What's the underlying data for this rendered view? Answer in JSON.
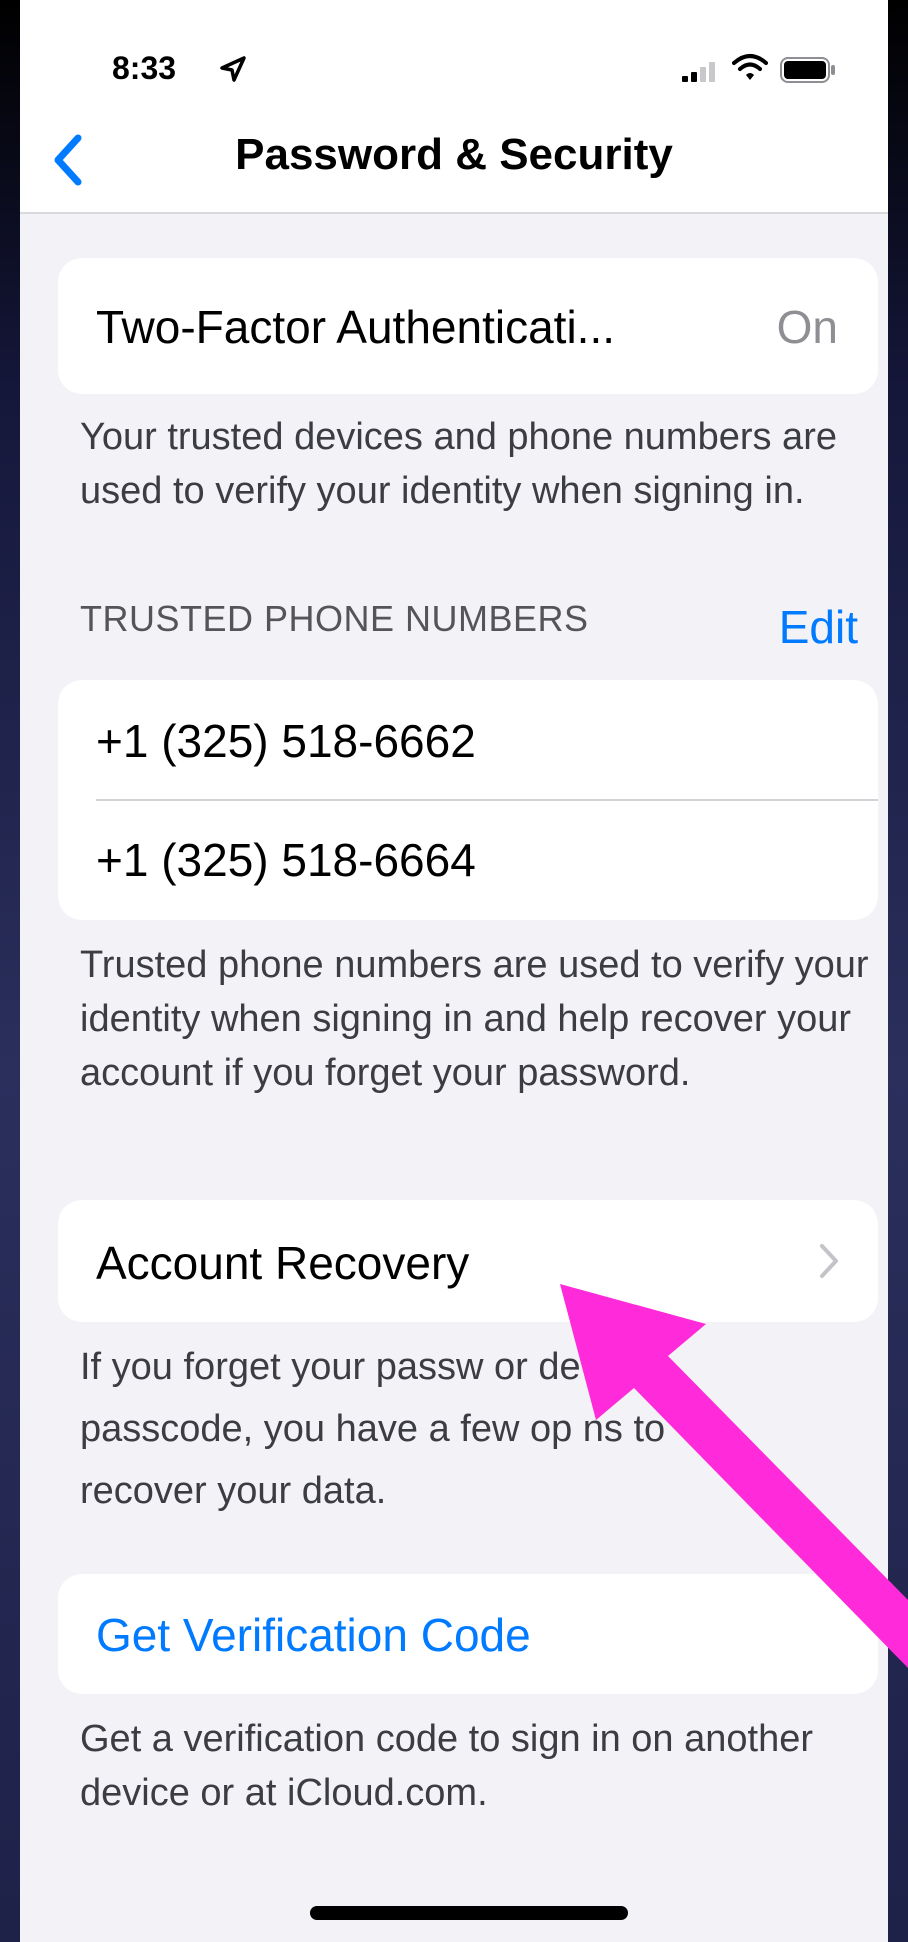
{
  "status_bar": {
    "time": "8:33"
  },
  "nav": {
    "title": "Password & Security"
  },
  "two_factor": {
    "label": "Two-Factor Authenticati...",
    "value": "On"
  },
  "two_factor_footer": "Your trusted devices and phone numbers are used to verify your identity when signing in.",
  "trusted_numbers": {
    "header": "TRUSTED PHONE NUMBERS",
    "edit_label": "Edit",
    "numbers": [
      "+1 (325) 518-6662",
      "+1 (325) 518-6664"
    ],
    "footer": "Trusted phone numbers are used to verify your identity when signing in and help recover your account if you forget your password."
  },
  "account_recovery": {
    "label": "Account Recovery",
    "footer_lines": [
      "If you forget your passw or device",
      "passcode, you have a few op ns to",
      "recover your data."
    ]
  },
  "verification": {
    "label": "Get Verification Code",
    "footer": "Get a verification code to sign in on another device or at iCloud.com."
  },
  "colors": {
    "accent": "#007aff",
    "annotation_arrow": "#ff2ad9",
    "background": "#f2f2f7"
  },
  "icons": {
    "back": "chevron-left-icon",
    "location": "location-arrow-icon",
    "signal": "cellular-signal-icon",
    "wifi": "wifi-icon",
    "battery": "battery-icon",
    "disclosure": "chevron-right-icon"
  }
}
